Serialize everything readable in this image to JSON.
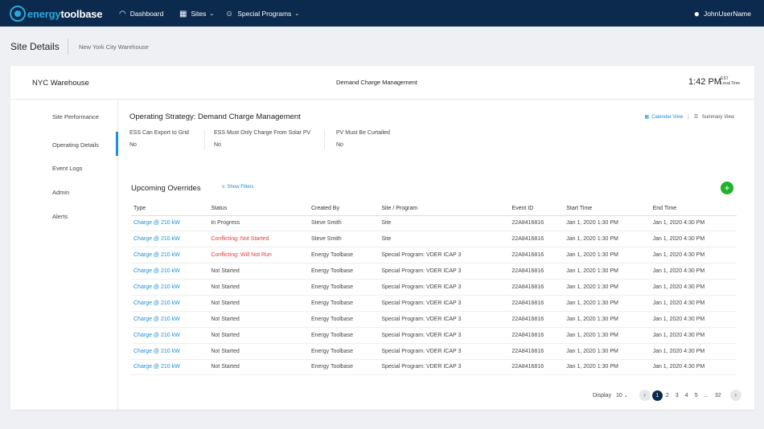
{
  "nav": {
    "logo_a": "energy",
    "logo_b": "toolbase",
    "dashboard": "Dashboard",
    "sites": "Sites",
    "programs": "Special Programs",
    "user": "JohnUserName"
  },
  "page": {
    "title": "Site Details",
    "subtitle": "New York City Warehouse"
  },
  "site": {
    "name": "NYC Warehouse",
    "strategy": "Demand Charge Management",
    "time": "1:42 PM",
    "tz": "EST",
    "tz_label": "Local Time"
  },
  "sidebar": {
    "items": [
      {
        "label": "Site Performance"
      },
      {
        "label": "Operating Details"
      },
      {
        "label": "Event Logs"
      },
      {
        "label": "Admin"
      },
      {
        "label": "Alerts"
      }
    ]
  },
  "strategy": {
    "title": "Operating Strategy: Demand Charge Management",
    "calendar_view": "Calendar View",
    "summary_view": "Summary View",
    "options": [
      {
        "label": "ESS Can Export to Grid",
        "value": "No"
      },
      {
        "label": "ESS Must Only Charge From Solar PV",
        "value": "No"
      },
      {
        "label": "PV Must Be Curtailed",
        "value": "No"
      }
    ]
  },
  "overrides": {
    "title": "Upcoming Overrides",
    "filters": "Show Filters",
    "add": "+",
    "headers": [
      "Type",
      "Status",
      "Created By",
      "Site / Program",
      "Event ID",
      "Start Time",
      "End Time"
    ],
    "rows": [
      [
        "Charge @ 210 kW",
        "In Progress",
        "Steve Smith",
        "Site",
        "22A8416816",
        "Jan 1, 2020 1:30 PM",
        "Jan 1, 2020 4:30 PM"
      ],
      [
        "Charge @ 210 kW",
        "Conflicting: Not Started",
        "Steve Smith",
        "Site",
        "22A8416816",
        "Jan 1, 2020 1:30 PM",
        "Jan 1, 2020 4:30 PM"
      ],
      [
        "Charge @ 210 kW",
        "Conflicting: Will Not Run",
        "Energy Toolbase",
        "Special Program: VDER ICAP 3",
        "22A8416816",
        "Jan 1, 2020 1:30 PM",
        "Jan 1, 2020 4:30 PM"
      ],
      [
        "Charge @ 210 kW",
        "Not Started",
        "Energy Toolbase",
        "Special Program: VDER ICAP 3",
        "22A8416816",
        "Jan 1, 2020 1:30 PM",
        "Jan 1, 2020 4:30 PM"
      ],
      [
        "Charge @ 210 kW",
        "Not Started",
        "Energy Toolbase",
        "Special Program: VDER ICAP 3",
        "22A8416816",
        "Jan 1, 2020 1:30 PM",
        "Jan 1, 2020 4:30 PM"
      ],
      [
        "Charge @ 210 kW",
        "Not Started",
        "Energy Toolbase",
        "Special Program: VDER ICAP 3",
        "22A8416816",
        "Jan 1, 2020 1:30 PM",
        "Jan 1, 2020 4:30 PM"
      ],
      [
        "Charge @ 210 kW",
        "Not Started",
        "Energy Toolbase",
        "Special Program: VDER ICAP 3",
        "22A8416816",
        "Jan 1, 2020 1:30 PM",
        "Jan 1, 2020 4:30 PM"
      ],
      [
        "Charge @ 210 kW",
        "Not Started",
        "Energy Toolbase",
        "Special Program: VDER ICAP 3",
        "22A8416816",
        "Jan 1, 2020 1:30 PM",
        "Jan 1, 2020 4:30 PM"
      ],
      [
        "Charge @ 210 kW",
        "Not Started",
        "Energy Toolbase",
        "Special Program: VDER ICAP 3",
        "22A8416816",
        "Jan 1, 2020 1:30 PM",
        "Jan 1, 2020 4:30 PM"
      ],
      [
        "Charge @ 210 kW",
        "Not Started",
        "Energy Toolbase",
        "Special Program: VDER ICAP 3",
        "22A8416816",
        "Jan 1, 2020 1:30 PM",
        "Jan 1, 2020 4:30 PM"
      ]
    ],
    "status_colors": {
      "conflict": "#e03b3b",
      "link": "#1b8fd6"
    }
  },
  "pagination": {
    "display_label": "Display",
    "page_size": "10",
    "pages": [
      "1",
      "2",
      "3",
      "4",
      "5"
    ],
    "ellipsis": "...",
    "last": "32",
    "current": "1"
  }
}
